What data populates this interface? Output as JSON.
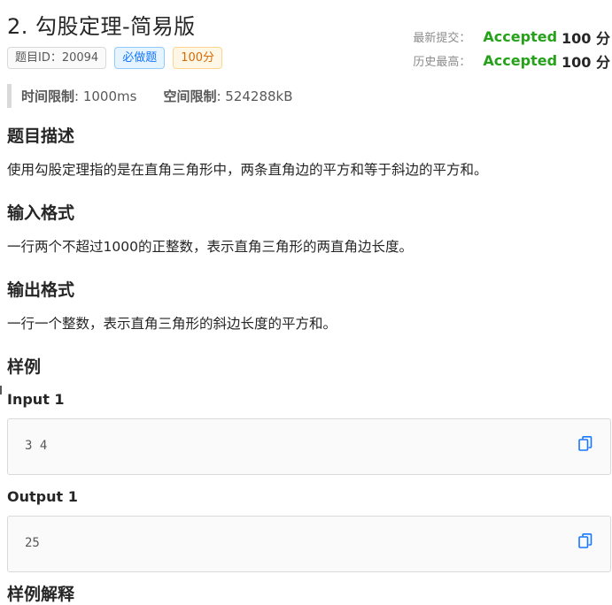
{
  "problem": {
    "title": "2. 勾股定理-简易版",
    "tags": {
      "id": "题目ID：20094",
      "required": "必做题",
      "score": "100分"
    }
  },
  "status": {
    "latest_label": "最新提交：",
    "latest_verdict": "Accepted",
    "latest_score": "100 分",
    "best_label": "历史最高：",
    "best_verdict": "Accepted",
    "best_score": "100 分"
  },
  "limits": {
    "time_label": "时间限制",
    "time_value": ": 1000ms",
    "memory_label": "空间限制",
    "memory_value": ": 524288kB"
  },
  "sections": {
    "description_title": "题目描述",
    "description_text": "使用勾股定理指的是在直角三角形中，两条直角边的平方和等于斜边的平方和。",
    "input_title": "输入格式",
    "input_text": "一行两个不超过1000的正整数，表示直角三角形的两直角边长度。",
    "output_title": "输出格式",
    "output_text": "一行一个整数，表示直角三角形的斜边长度的平方和。",
    "samples_title": "样例",
    "explanation_title": "样例解释"
  },
  "samples": {
    "input_label": "Input 1",
    "input_value": "3 4",
    "output_label": "Output 1",
    "output_value": "25"
  },
  "colors": {
    "accepted": "#25a21a",
    "primary": "#1677ff",
    "warning": "#d46b08"
  }
}
